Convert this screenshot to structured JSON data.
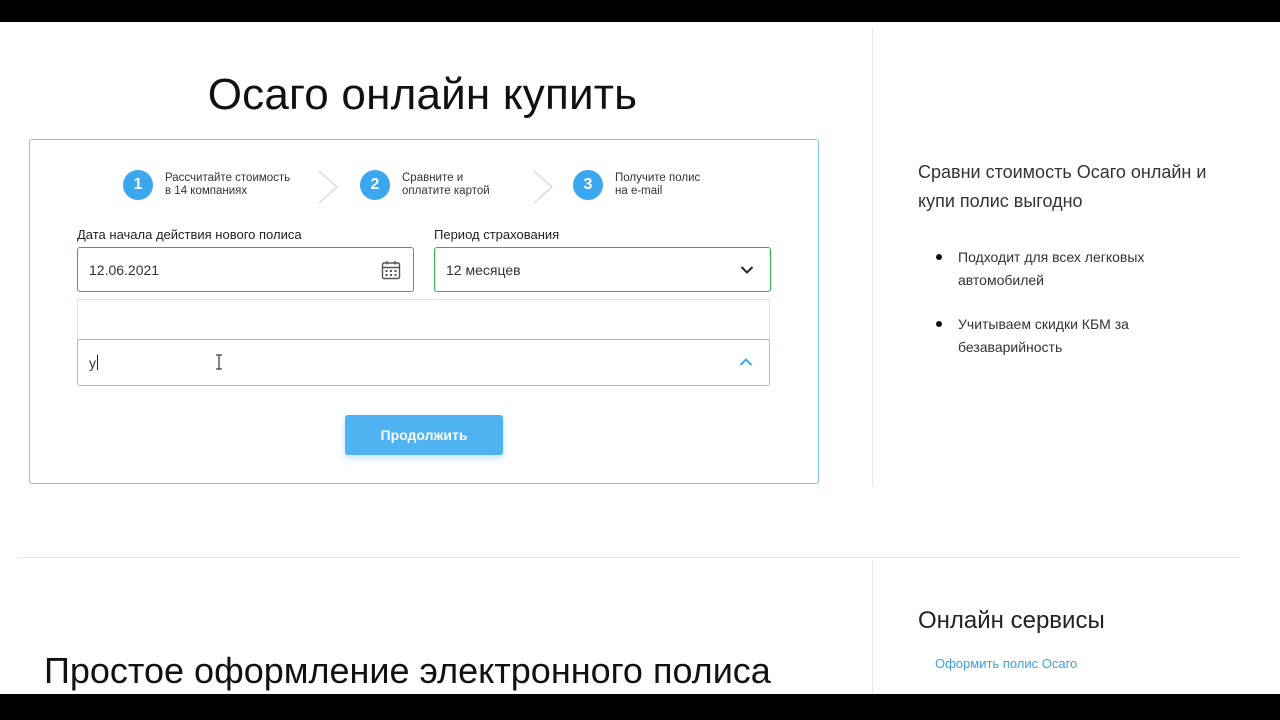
{
  "page": {
    "title": "Осаго онлайн купить",
    "section_title": "Простое оформление электронного полиса"
  },
  "steps": [
    {
      "num": "1",
      "text": "Рассчитайте стоимость\nв 14 компаниях"
    },
    {
      "num": "2",
      "text": "Сравните и\nоплатите картой"
    },
    {
      "num": "3",
      "text": "Получите полис\nна e-mail"
    }
  ],
  "form": {
    "start_date_label": "Дата начала действия нового полиса",
    "start_date_value": "12.06.2021",
    "period_label": "Период страхования",
    "period_value": "12 месяцев",
    "search_value": "у",
    "continue_label": "Продолжить"
  },
  "sidebar": {
    "heading": "Сравни стоимость Осаго онлайн и купи полис выгодно",
    "bullets": [
      "Подходит для всех легковых автомобилей",
      "Учитываем скидки КБМ за безаварийность"
    ],
    "services_title": "Онлайн сервисы",
    "services_link": "Оформить полис Осаго"
  },
  "colors": {
    "accent": "#3aa7ef",
    "valid_border": "#2db34a",
    "card_border": "#7fc4ec",
    "link": "#3e9fe0"
  },
  "icons": [
    "calendar-icon",
    "chevron-down-icon",
    "chevron-up-icon",
    "step-arrow-icon",
    "text-cursor-icon"
  ]
}
